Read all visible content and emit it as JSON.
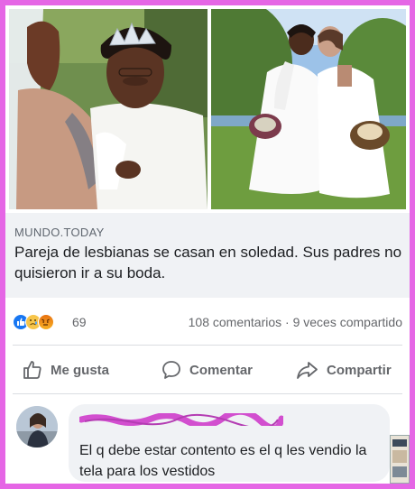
{
  "post": {
    "source": "MUNDO.TODAY",
    "headline": "Pareja de lesbianas se casan en soledad. Sus padres no quisieron ir a su boda."
  },
  "stats": {
    "reaction_count": "69",
    "comments": "108 comentarios",
    "separator": "·",
    "shares": "9 veces compartido"
  },
  "actions": {
    "like": "Me gusta",
    "comment": "Comentar",
    "share": "Compartir"
  },
  "comment": {
    "text": "El q debe estar contento es el q les vendio la tela para los vestidos"
  },
  "colors": {
    "border": "#e566e5",
    "like_blue": "#1877f2",
    "text_gray": "#65676b",
    "scribble": "#d24fcf"
  },
  "icons": {
    "like": "thumbs-up-icon",
    "comment": "speech-bubble-icon",
    "share": "share-arrow-icon"
  }
}
